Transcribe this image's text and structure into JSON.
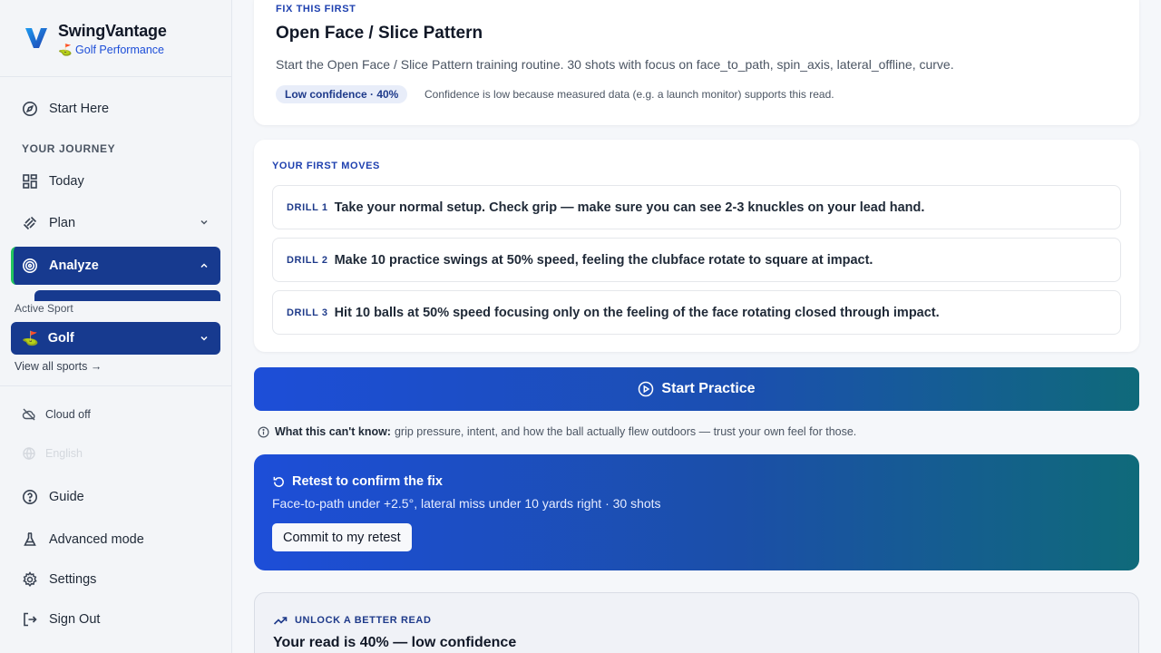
{
  "brand": {
    "name": "SwingVantage",
    "sub": "⛳ Golf Performance"
  },
  "sidebar": {
    "start_here": "Start Here",
    "journey_label": "YOUR JOURNEY",
    "today": "Today",
    "plan": "Plan",
    "analyze": "Analyze",
    "active_sport_label": "Active Sport",
    "sport": "Golf",
    "view_all": "View all sports →",
    "cloud": "Cloud off",
    "language": "English",
    "guide": "Guide",
    "advanced": "Advanced mode",
    "settings": "Settings",
    "sign_out": "Sign Out"
  },
  "fix": {
    "eyebrow": "FIX THIS FIRST",
    "title": "Open Face / Slice Pattern",
    "description": "Start the Open Face / Slice Pattern training routine. 30 shots with focus on face_to_path, spin_axis, lateral_offline, curve.",
    "confidence": "Low confidence · 40%",
    "confidence_note": "Confidence is low because measured data (e.g. a launch monitor) supports this read."
  },
  "moves": {
    "eyebrow": "YOUR FIRST MOVES",
    "drills": [
      {
        "label": "DRILL 1",
        "text": "Take your normal setup. Check grip — make sure you can see 2-3 knuckles on your lead hand."
      },
      {
        "label": "DRILL 2",
        "text": "Make 10 practice swings at 50% speed, feeling the clubface rotate to square at impact."
      },
      {
        "label": "DRILL 3",
        "text": "Hit 10 balls at 50% speed focusing only on the feeling of the face rotating closed through impact."
      }
    ]
  },
  "practice": {
    "label": "Start Practice"
  },
  "cantknow": {
    "bold": "What this can't know:",
    "text": "grip pressure, intent, and how the ball actually flew outdoors — trust your own feel for those."
  },
  "retest": {
    "title": "Retest to confirm the fix",
    "description": "Face-to-path under +2.5°, lateral miss under 10 yards right · 30 shots",
    "button": "Commit to my retest"
  },
  "unlock": {
    "eyebrow": "UNLOCK A BETTER READ",
    "title": "Your read is 40% — low confidence"
  },
  "colors": {
    "accent": "#173a8f",
    "green": "#22c55e",
    "link": "#1d4ed8"
  }
}
